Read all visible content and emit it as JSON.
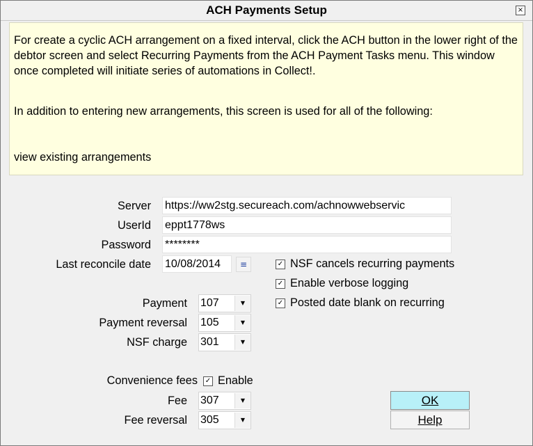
{
  "window": {
    "title": "ACH Payments Setup",
    "close_symbol": "×"
  },
  "info": {
    "paragraph1": "For create a cyclic ACH arrangement on a fixed interval, click the ACH button in the lower right of the debtor screen and select Recurring Payments from the ACH Payment Tasks menu.  This window once completed will initiate series of automations in Collect!.",
    "paragraph2": "In addition to entering new arrangements, this screen is used for all of the following:",
    "paragraph3": "view existing arrangements"
  },
  "fields": {
    "server_label": "Server",
    "server_value": "https://ww2stg.secureach.com/achnowwebservic",
    "userid_label": "UserId",
    "userid_value": "eppt1778ws",
    "password_label": "Password",
    "password_value": "********",
    "reconcile_label": "Last reconcile date",
    "reconcile_value": "10/08/2014"
  },
  "options": {
    "nsf_cancels": {
      "label": "NSF cancels recurring payments",
      "checked": true
    },
    "verbose_logging": {
      "label": "Enable verbose logging",
      "checked": true
    },
    "posted_blank": {
      "label": "Posted date blank on recurring",
      "checked": true
    }
  },
  "codes": {
    "payment_label": "Payment",
    "payment_value": "107",
    "payment_reversal_label": "Payment reversal",
    "payment_reversal_value": "105",
    "nsf_charge_label": "NSF charge",
    "nsf_charge_value": "301"
  },
  "fees": {
    "convenience_label": "Convenience fees",
    "enable_label": "Enable",
    "enable_checked": true,
    "fee_label": "Fee",
    "fee_value": "307",
    "fee_reversal_label": "Fee reversal",
    "fee_reversal_value": "305"
  },
  "buttons": {
    "ok_label": "OK",
    "help_label": "Help"
  },
  "glyphs": {
    "check": "✓",
    "dropdown": "▼",
    "calendar": "≡"
  },
  "icons": {
    "close": "close-icon",
    "calendar": "calendar-icon",
    "dropdown": "chevron-down-icon",
    "check": "check-icon"
  },
  "colors": {
    "info_background": "#ffffe0",
    "ok_button": "#b8f0f8",
    "window_background": "#f0f0f0"
  }
}
